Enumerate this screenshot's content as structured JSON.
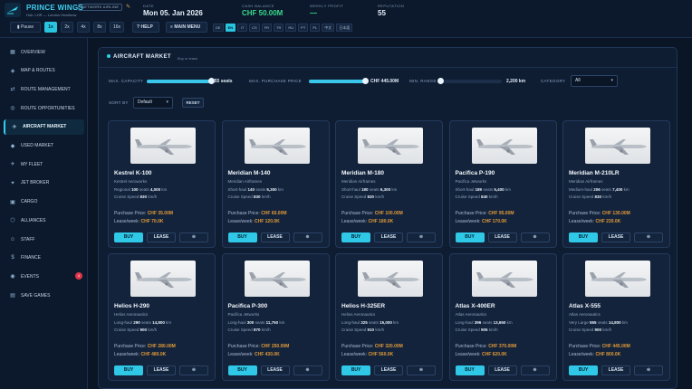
{
  "header": {
    "airline_name": "PRINCE WINGS",
    "network_badge": "NETWORK AIRLINE",
    "hub_line": "Hub: LHR — London Heathrow",
    "stats": [
      {
        "label": "DATE",
        "value": "Mon 05. Jan 2026",
        "color": "#e8f1fb"
      },
      {
        "label": "CASH BALANCE",
        "value": "CHF 50.00M",
        "color": "#39d98a"
      },
      {
        "label": "WEEKLY PROFIT",
        "value": "—",
        "color": "#39d98a"
      },
      {
        "label": "REPUTATION",
        "value": "55",
        "color": "#e8f1fb"
      }
    ],
    "speed": {
      "pause": "Pause",
      "options": [
        "1x",
        "2x",
        "4x",
        "8x",
        "16x"
      ],
      "active": "1x"
    },
    "help_label": "HELP",
    "main_menu_label": "MAIN MENU",
    "languages": [
      "DE",
      "EN",
      "IT",
      "CS",
      "FR",
      "TR",
      "RU",
      "PT",
      "PL",
      "中文",
      "日本語"
    ],
    "active_language": "EN"
  },
  "sidebar": {
    "items": [
      {
        "label": "OVERVIEW",
        "icon": "grid-icon"
      },
      {
        "label": "MAP & ROUTES",
        "icon": "map-icon"
      },
      {
        "label": "ROUTE MANAGEMENT",
        "icon": "route-icon"
      },
      {
        "label": "ROUTE OPPORTUNITIES",
        "icon": "opportunity-icon"
      },
      {
        "label": "AIRCRAFT MARKET",
        "icon": "plane-icon",
        "active": true
      },
      {
        "label": "USED MARKET",
        "icon": "tag-icon"
      },
      {
        "label": "MY FLEET",
        "icon": "fleet-icon"
      },
      {
        "label": "JET BROKER",
        "icon": "broker-icon"
      },
      {
        "label": "CARGO",
        "icon": "cargo-icon"
      },
      {
        "label": "ALLIANCES",
        "icon": "alliance-icon"
      },
      {
        "label": "STAFF",
        "icon": "staff-icon"
      },
      {
        "label": "FINANCE",
        "icon": "finance-icon"
      },
      {
        "label": "EVENTS",
        "icon": "events-icon",
        "badge": "4"
      },
      {
        "label": "SAVE GAMES",
        "icon": "save-icon"
      }
    ]
  },
  "market": {
    "title": "AIRCRAFT MARKET",
    "subtitle": "Buy or lease",
    "filters": {
      "capacity_label": "MAX. CAPACITY",
      "capacity_value": "555 seats",
      "capacity_fraction": 1.0,
      "price_label": "MAX. PURCHASE PRICE",
      "price_value": "CHF 445.00M",
      "price_fraction": 1.0,
      "range_label": "MIN. RANGE",
      "range_value": "2,200 km",
      "range_fraction": 0.0,
      "category_label": "CATEGORY",
      "category_value": "All",
      "sort_label": "SORT BY",
      "sort_value": "Default",
      "reset_label": "RESET"
    },
    "labels": {
      "seats": "seats",
      "km": "km",
      "cruise": "Cruise Speed",
      "kmh": "km/h",
      "purchase": "Purchase Price:",
      "lease": "Lease/week:",
      "buy_btn": "BUY",
      "lease_btn": "LEASE",
      "info_btn": "⊕"
    },
    "aircraft": [
      {
        "name": "Kestrel K-100",
        "maker": "Kestrel Aeroworks",
        "class": "Regional",
        "seats": "100",
        "range": "4,000",
        "speed": "830",
        "price": "CHF 35.00M",
        "lease": "CHF 70.0K"
      },
      {
        "name": "Meridian M-140",
        "maker": "Meridian Airframes",
        "class": "Short-haul",
        "seats": "140",
        "range": "6,300",
        "speed": "830",
        "price": "CHF 60.00M",
        "lease": "CHF 120.0K"
      },
      {
        "name": "Meridian M-180",
        "maker": "Meridian Airframes",
        "class": "Short-haul",
        "seats": "180",
        "range": "6,300",
        "speed": "830",
        "price": "CHF 100.00M",
        "lease": "CHF 180.0K"
      },
      {
        "name": "Pacifica P-190",
        "maker": "Pacifica Jetworks",
        "class": "Short-haul",
        "seats": "189",
        "range": "5,400",
        "speed": "840",
        "price": "CHF 95.00M",
        "lease": "CHF 170.0K"
      },
      {
        "name": "Meridian M-210LR",
        "maker": "Meridian Airframes",
        "class": "Medium-haul",
        "seats": "206",
        "range": "7,400",
        "speed": "830",
        "price": "CHF 130.00M",
        "lease": "CHF 230.0K"
      },
      {
        "name": "Helios H-290",
        "maker": "Helios Aeronautics",
        "class": "Long-haul",
        "seats": "290",
        "range": "14,800",
        "speed": "900",
        "price": "CHF 280.00M",
        "lease": "CHF 480.0K"
      },
      {
        "name": "Pacifica P-300",
        "maker": "Pacifica Jetworks",
        "class": "Long-haul",
        "seats": "300",
        "range": "11,750",
        "speed": "870",
        "price": "CHF 250.00M",
        "lease": "CHF 430.0K"
      },
      {
        "name": "Helios H-325ER",
        "maker": "Helios Aeronautics",
        "class": "Long-haul",
        "seats": "325",
        "range": "15,000",
        "speed": "910",
        "price": "CHF 320.00M",
        "lease": "CHF 560.0K"
      },
      {
        "name": "Atlas X-400ER",
        "maker": "Atlas Aeronautics",
        "class": "Long-haul",
        "seats": "396",
        "range": "13,650",
        "speed": "905",
        "price": "CHF 370.00M",
        "lease": "CHF 620.0K"
      },
      {
        "name": "Atlas X-555",
        "maker": "Atlas Aeronautics",
        "class": "Very Large",
        "seats": "555",
        "range": "14,800",
        "speed": "900",
        "price": "CHF 445.00M",
        "lease": "CHF 800.0K"
      }
    ]
  }
}
